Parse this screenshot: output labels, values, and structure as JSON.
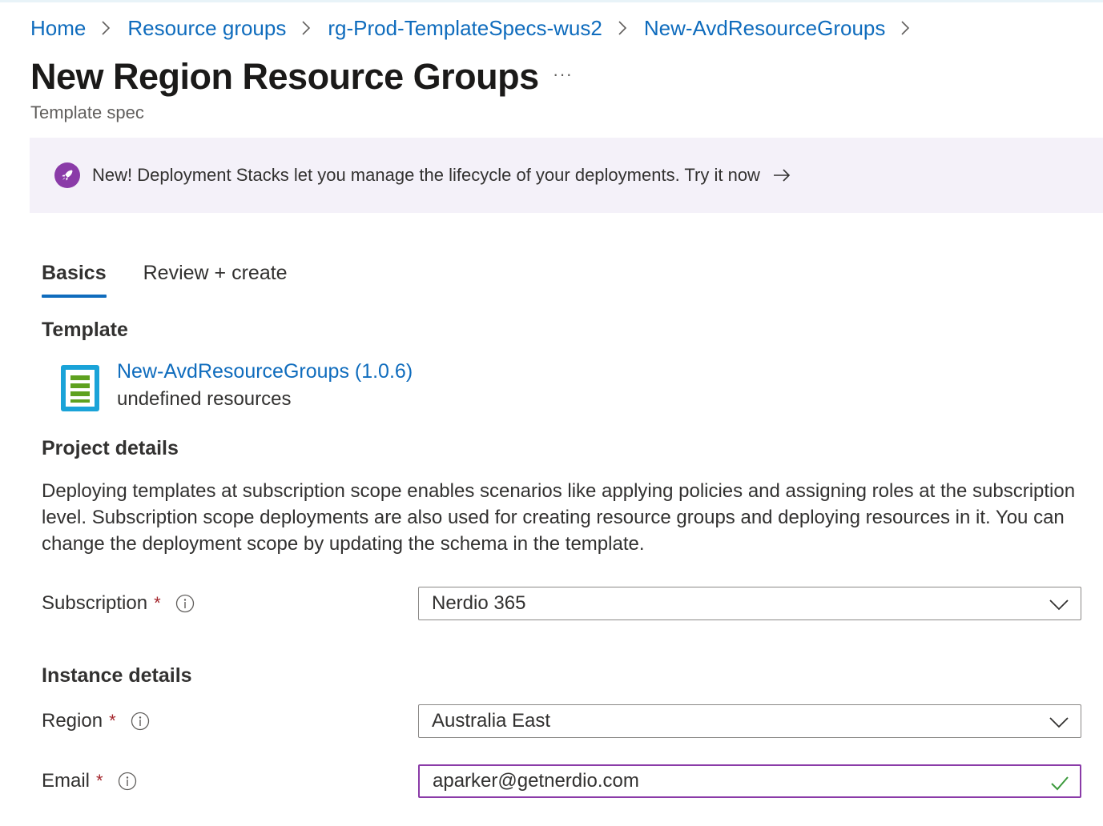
{
  "breadcrumb": {
    "items": [
      "Home",
      "Resource groups",
      "rg-Prod-TemplateSpecs-wus2",
      "New-AvdResourceGroups"
    ]
  },
  "header": {
    "title": "New Region Resource Groups",
    "more": "···",
    "subtitle": "Template spec"
  },
  "banner": {
    "text": "New! Deployment Stacks let you manage the lifecycle of your deployments. Try it now"
  },
  "tabs": [
    {
      "label": "Basics",
      "active": true
    },
    {
      "label": "Review + create",
      "active": false
    }
  ],
  "template": {
    "heading": "Template",
    "name": "New-AvdResourceGroups (1.0.6)",
    "resources": "undefined resources"
  },
  "project": {
    "heading": "Project details",
    "description": "Deploying templates at subscription scope enables scenarios like applying policies and assigning roles at the subscription level. Subscription scope deployments are also used for creating resource groups and deploying resources in it. You can change the deployment scope by updating the schema in the template.",
    "subscription_label": "Subscription",
    "subscription_value": "Nerdio 365"
  },
  "instance": {
    "heading": "Instance details",
    "region_label": "Region",
    "region_value": "Australia East",
    "email_label": "Email",
    "email_value": "aparker@getnerdio.com"
  },
  "required_mark": "*",
  "colors": {
    "link": "#0f6cbd",
    "banner_bg": "#f4f1f9",
    "banner_icon": "#8a3ba8",
    "required": "#a4262c",
    "valid_check": "#3c9a3c"
  }
}
